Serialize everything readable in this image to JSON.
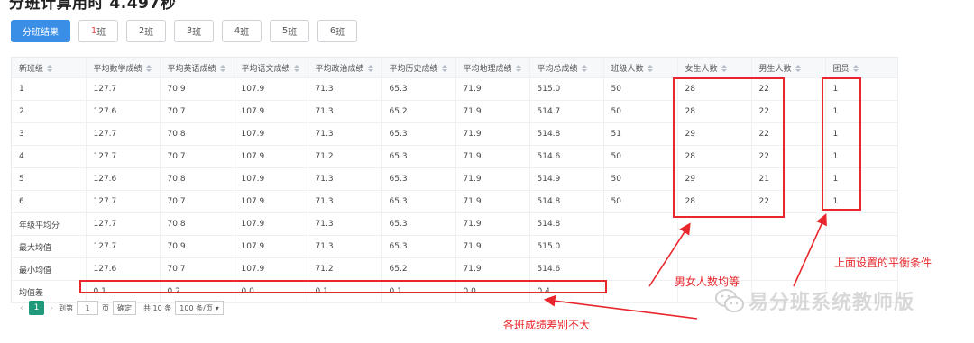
{
  "page": {
    "title": "分班计算用时 4.497秒"
  },
  "tabs": [
    {
      "label": "分班结果",
      "active": true
    },
    {
      "num": "1",
      "suffix": "班"
    },
    {
      "num": "2",
      "suffix": "班"
    },
    {
      "num": "3",
      "suffix": "班"
    },
    {
      "num": "4",
      "suffix": "班"
    },
    {
      "num": "5",
      "suffix": "班"
    },
    {
      "num": "6",
      "suffix": "班"
    }
  ],
  "table": {
    "columns": [
      "新班级",
      "平均数学成绩",
      "平均英语成绩",
      "平均语文成绩",
      "平均政治成绩",
      "平均历史成绩",
      "平均地理成绩",
      "平均总成绩",
      "班级人数",
      "女生人数",
      "男生人数",
      "团员"
    ],
    "rows": [
      [
        "1",
        "127.7",
        "70.9",
        "107.9",
        "71.3",
        "65.3",
        "71.9",
        "515.0",
        "50",
        "28",
        "22",
        "1"
      ],
      [
        "2",
        "127.6",
        "70.7",
        "107.9",
        "71.3",
        "65.2",
        "71.9",
        "514.7",
        "50",
        "28",
        "22",
        "1"
      ],
      [
        "3",
        "127.7",
        "70.8",
        "107.9",
        "71.3",
        "65.3",
        "71.9",
        "514.8",
        "51",
        "29",
        "22",
        "1"
      ],
      [
        "4",
        "127.7",
        "70.7",
        "107.9",
        "71.2",
        "65.3",
        "71.9",
        "514.6",
        "50",
        "28",
        "22",
        "1"
      ],
      [
        "5",
        "127.6",
        "70.8",
        "107.9",
        "71.3",
        "65.3",
        "71.9",
        "514.9",
        "50",
        "29",
        "21",
        "1"
      ],
      [
        "6",
        "127.7",
        "70.7",
        "107.9",
        "71.3",
        "65.3",
        "71.9",
        "514.8",
        "50",
        "28",
        "22",
        "1"
      ],
      [
        "年级平均分",
        "127.7",
        "70.8",
        "107.9",
        "71.3",
        "65.3",
        "71.9",
        "514.8",
        "",
        "",
        "",
        ""
      ],
      [
        "最大均值",
        "127.7",
        "70.9",
        "107.9",
        "71.3",
        "65.3",
        "71.9",
        "515.0",
        "",
        "",
        "",
        ""
      ],
      [
        "最小均值",
        "127.6",
        "70.7",
        "107.9",
        "71.2",
        "65.2",
        "71.9",
        "514.6",
        "",
        "",
        "",
        ""
      ],
      [
        "均值差",
        "0.1",
        "0.2",
        "0.0",
        "0.1",
        "0.1",
        "0.0",
        "0.4",
        "",
        "",
        "",
        ""
      ]
    ]
  },
  "pagination": {
    "current_page": "1",
    "goto_label": "到第",
    "page_input": "1",
    "page_unit": "页",
    "confirm": "确定",
    "total": "共 10 条",
    "page_size": "100 条/页"
  },
  "annotations": {
    "gender_balance": "男女人数均等",
    "balance_conditions": "上面设置的平衡条件",
    "score_gap": "各班成绩差别不大"
  },
  "watermark": {
    "text": "易分班系统教师版",
    "icon": "wechat-icon"
  },
  "colors": {
    "accent": "#3a8ee6",
    "highlight": "#e8262b",
    "pager_active": "#1e9a7a"
  }
}
